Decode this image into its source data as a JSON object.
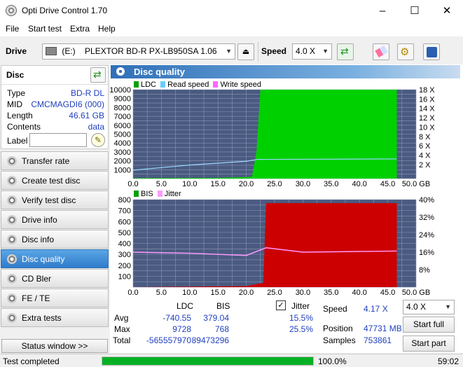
{
  "window": {
    "title": "Opti Drive Control 1.70"
  },
  "menu": [
    "File",
    "Start test",
    "Extra",
    "Help"
  ],
  "toolbar": {
    "drive_label": "Drive",
    "drive_letter": "(E:)",
    "drive_name": "PLEXTOR BD-R  PX-LB950SA 1.06",
    "speed_label": "Speed",
    "speed_value": "4.0 X"
  },
  "disc": {
    "title": "Disc",
    "type_label": "Type",
    "type": "BD-R DL",
    "mid_label": "MID",
    "mid": "CMCMAGDI6 (000)",
    "length_label": "Length",
    "length": "46.61 GB",
    "contents_label": "Contents",
    "contents": "data",
    "label_label": "Label",
    "label_value": ""
  },
  "nav": [
    "Transfer rate",
    "Create test disc",
    "Verify test disc",
    "Drive info",
    "Disc info",
    "Disc quality",
    "CD Bler",
    "FE / TE",
    "Extra tests"
  ],
  "nav_active": "Disc quality",
  "status_window_btn": "Status window >>",
  "panel": {
    "title": "Disc quality"
  },
  "chart_data": [
    {
      "type": "area",
      "legend": [
        "LDC",
        "Read speed",
        "Write speed"
      ],
      "legend_colors": [
        "#00c800",
        "#66ccff",
        "#ff66ff"
      ],
      "x_ticks": [
        "0.0",
        "5.0",
        "10.0",
        "15.0",
        "20.0",
        "25.0",
        "30.0",
        "35.0",
        "40.0",
        "45.0",
        "50.0 GB"
      ],
      "y_ticks_left": [
        "10000",
        "9000",
        "8000",
        "7000",
        "6000",
        "5000",
        "4000",
        "3000",
        "2000",
        "1000"
      ],
      "y_ticks_right": [
        "18 X",
        "16 X",
        "14 X",
        "12 X",
        "10 X",
        "8 X",
        "6 X",
        "4 X",
        "2 X"
      ],
      "xlim": [
        0,
        50
      ],
      "ylim": [
        0,
        10000
      ],
      "ldc": [
        [
          0,
          50
        ],
        [
          15,
          80
        ],
        [
          21,
          200
        ],
        [
          21.8,
          3000
        ],
        [
          22.5,
          10000
        ],
        [
          46.6,
          10000
        ]
      ],
      "read_speed": [
        [
          0,
          1.8
        ],
        [
          10,
          2.9
        ],
        [
          20,
          3.7
        ],
        [
          22,
          4.1
        ],
        [
          46.6,
          4.2
        ]
      ]
    },
    {
      "type": "area",
      "legend": [
        "BIS",
        "Jitter"
      ],
      "legend_colors": [
        "#00c800",
        "#ff99ff"
      ],
      "x_ticks": [
        "0.0",
        "5.0",
        "10.0",
        "15.0",
        "20.0",
        "25.0",
        "30.0",
        "35.0",
        "40.0",
        "45.0",
        "50.0 GB"
      ],
      "y_ticks_left": [
        "800",
        "700",
        "600",
        "500",
        "400",
        "300",
        "200",
        "100"
      ],
      "y_ticks_right": [
        "40%",
        "32%",
        "24%",
        "16%",
        "8%"
      ],
      "xlim": [
        0,
        50
      ],
      "ylim": [
        0,
        800
      ],
      "bis": [
        [
          0,
          0
        ],
        [
          20,
          10
        ],
        [
          23,
          40
        ],
        [
          23.5,
          768
        ],
        [
          46.6,
          768
        ]
      ],
      "jitter": [
        [
          0,
          16
        ],
        [
          10,
          15.5
        ],
        [
          20,
          14.5
        ],
        [
          23.5,
          18
        ],
        [
          30,
          16
        ],
        [
          46.6,
          16.5
        ]
      ]
    }
  ],
  "stats": {
    "ldc_h": "LDC",
    "bis_h": "BIS",
    "avg_l": "Avg",
    "max_l": "Max",
    "total_l": "Total",
    "ldc_avg": "-740.55",
    "ldc_max": "9728",
    "ldc_total": "-565557970",
    "bis_avg": "379.04",
    "bis_max": "768",
    "bis_total": "89473296",
    "jitter_label": "Jitter",
    "jitter_avg": "15.5%",
    "jitter_max": "25.5%",
    "speed_label": "Speed",
    "speed": "4.17 X",
    "position_label": "Position",
    "position": "47731 MB",
    "samples_label": "Samples",
    "samples": "753861",
    "speed_select": "4.0 X",
    "start_full": "Start full",
    "start_part": "Start part"
  },
  "statusbar": {
    "text": "Test completed",
    "progress": "100.0%",
    "progress_value": 1.0,
    "time": "59:02"
  }
}
